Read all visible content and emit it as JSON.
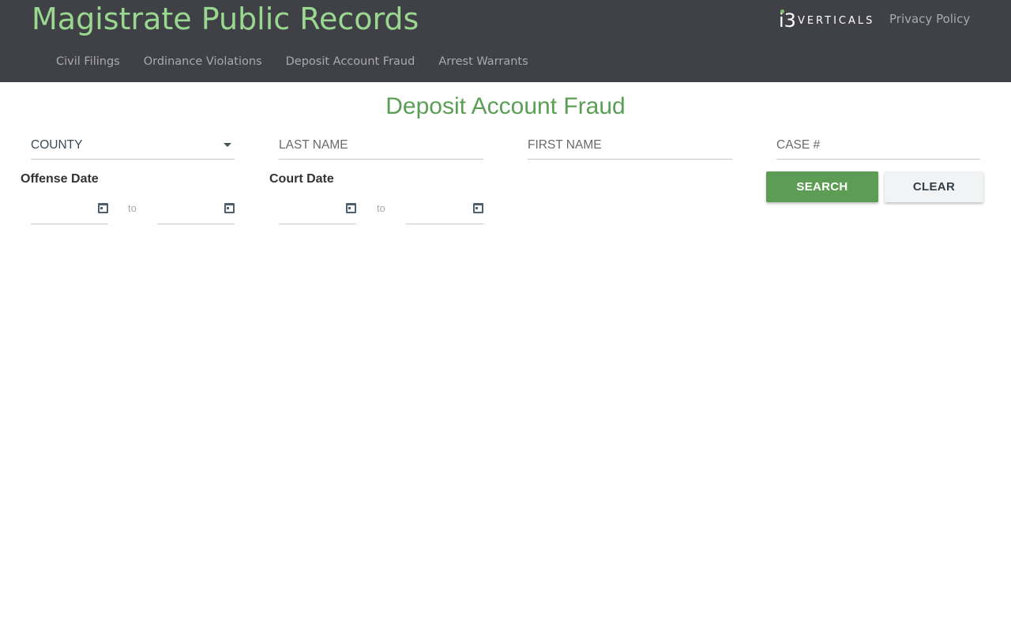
{
  "header": {
    "site_title": "Magistrate Public Records",
    "brand_mark": "i3",
    "brand_text": "VERTICALS",
    "privacy_label": "Privacy Policy",
    "colors": {
      "background": "#404147",
      "title": "#9ad88f",
      "links": "#a9aab0"
    }
  },
  "nav": {
    "items": [
      {
        "label": "Civil Filings"
      },
      {
        "label": "Ordinance Violations"
      },
      {
        "label": "Deposit Account Fraud"
      },
      {
        "label": "Arrest Warrants"
      }
    ]
  },
  "main": {
    "page_title": "Deposit Account Fraud",
    "title_color": "#5b9f56",
    "filters": {
      "county": {
        "label": "COUNTY",
        "icon": "caret-down-icon"
      },
      "last_name": {
        "placeholder": "LAST NAME",
        "value": ""
      },
      "first_name": {
        "placeholder": "FIRST NAME",
        "value": ""
      },
      "case_number": {
        "placeholder": "CASE #",
        "value": ""
      }
    },
    "offense_date": {
      "label": "Offense Date",
      "separator": "to",
      "from": "",
      "to": "",
      "icon": "calendar-icon"
    },
    "court_date": {
      "label": "Court Date",
      "separator": "to",
      "from": "",
      "to": "",
      "icon": "calendar-icon"
    },
    "buttons": {
      "search_label": "SEARCH",
      "clear_label": "CLEAR",
      "search_color": "#5d9c55",
      "clear_color": "#f1f3f4"
    }
  }
}
